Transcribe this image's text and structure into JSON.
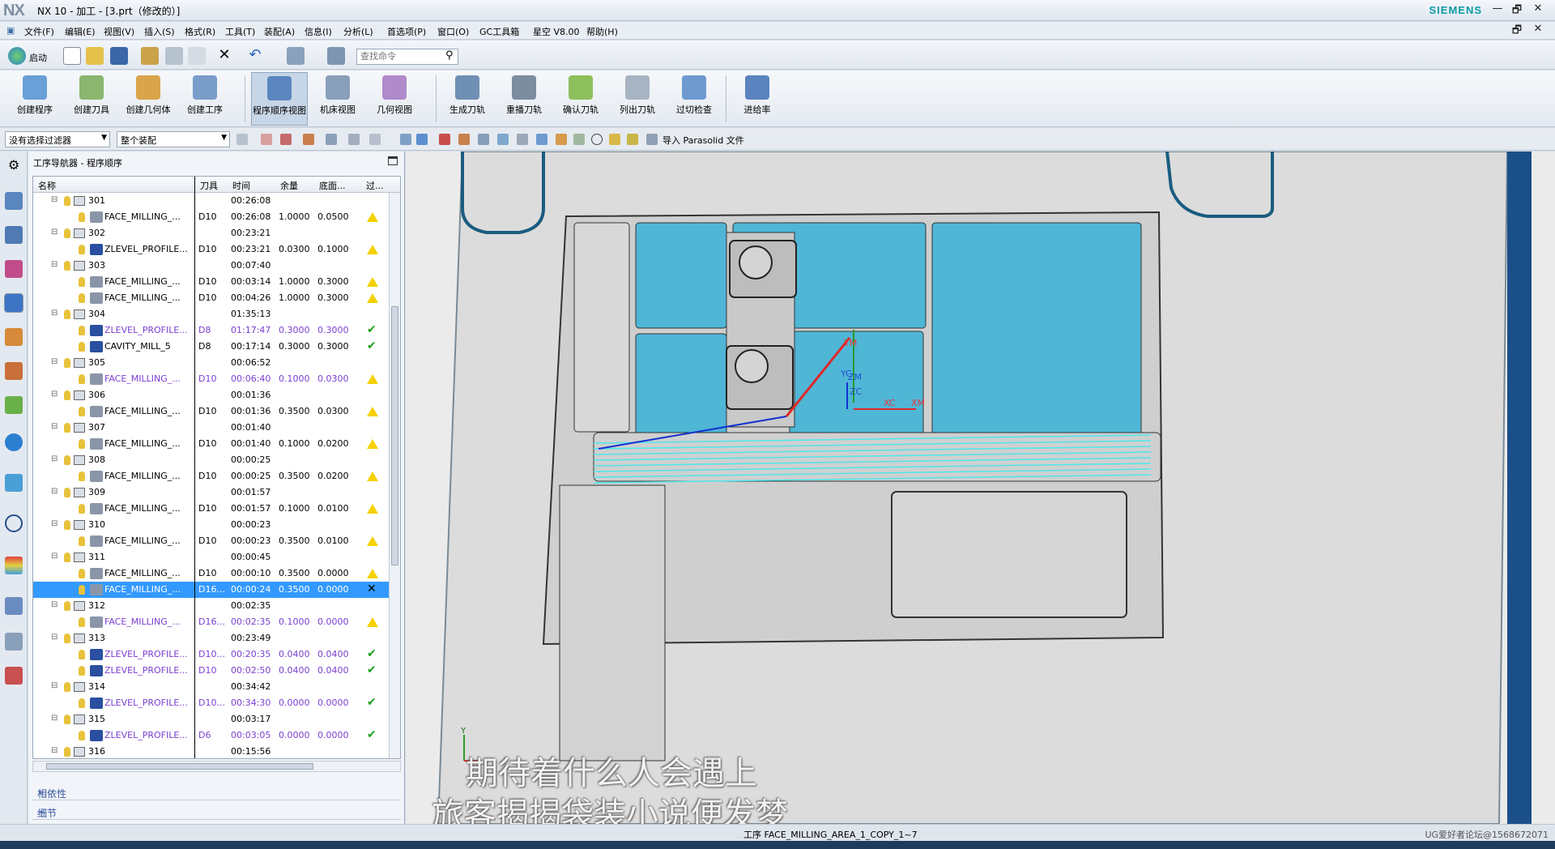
{
  "window": {
    "logo": "NX",
    "title": "NX 10 - 加工 - [3.prt（修改的）]",
    "brand": "SIEMENS",
    "min": "—",
    "restore": "🗗",
    "close": "✕"
  },
  "menu": [
    "文件(F)",
    "编辑(E)",
    "视图(V)",
    "插入(S)",
    "格式(R)",
    "工具(T)",
    "装配(A)",
    "信息(I)",
    "分析(L)",
    "首选项(P)",
    "窗口(O)",
    "GC工具箱",
    "星空 V8.00",
    "帮助(H)"
  ],
  "quick": {
    "start_label": "启动",
    "search_placeholder": "查找命令"
  },
  "ribbon": [
    "创建程序",
    "创建刀具",
    "创建几何体",
    "创建工序",
    "程序顺序视图",
    "机床视图",
    "几何视图",
    "生成刀轨",
    "重播刀轨",
    "确认刀轨",
    "列出刀轨",
    "过切检查",
    "进给率"
  ],
  "filter": {
    "selection_filter": "没有选择过滤器",
    "assembly_scope": "整个装配",
    "import_parasolid": "导入 Parasolid 文件"
  },
  "navigator": {
    "title": "工序导航器 - 程序顺序",
    "columns": [
      "名称",
      "刀具",
      "时间",
      "余量",
      "底面...",
      "过..."
    ],
    "rows": [
      {
        "kind": "group",
        "name": "301",
        "tool": "",
        "time": "00:26:08",
        "stock": "",
        "floor": "",
        "status": ""
      },
      {
        "kind": "op",
        "name": "FACE_MILLING_...",
        "tool": "D10",
        "time": "00:26:08",
        "stock": "1.0000",
        "floor": "0.0500",
        "status": "warn",
        "purple": false
      },
      {
        "kind": "group",
        "name": "302",
        "tool": "",
        "time": "00:23:21",
        "stock": "",
        "floor": "",
        "status": ""
      },
      {
        "kind": "op",
        "name": "ZLEVEL_PROFILE...",
        "tool": "D10",
        "time": "00:23:21",
        "stock": "0.0300",
        "floor": "0.1000",
        "status": "warn",
        "purple": false
      },
      {
        "kind": "group",
        "name": "303",
        "tool": "",
        "time": "00:07:40",
        "stock": "",
        "floor": "",
        "status": ""
      },
      {
        "kind": "op",
        "name": "FACE_MILLING_...",
        "tool": "D10",
        "time": "00:03:14",
        "stock": "1.0000",
        "floor": "0.3000",
        "status": "warn",
        "purple": false
      },
      {
        "kind": "op",
        "name": "FACE_MILLING_...",
        "tool": "D10",
        "time": "00:04:26",
        "stock": "1.0000",
        "floor": "0.3000",
        "status": "warn",
        "purple": false
      },
      {
        "kind": "group",
        "name": "304",
        "tool": "",
        "time": "01:35:13",
        "stock": "",
        "floor": "",
        "status": ""
      },
      {
        "kind": "op",
        "name": "ZLEVEL_PROFILE...",
        "tool": "D8",
        "time": "01:17:47",
        "stock": "0.3000",
        "floor": "0.3000",
        "status": "ok",
        "purple": true
      },
      {
        "kind": "op",
        "name": "CAVITY_MILL_5",
        "tool": "D8",
        "time": "00:17:14",
        "stock": "0.3000",
        "floor": "0.3000",
        "status": "ok",
        "purple": false
      },
      {
        "kind": "group",
        "name": "305",
        "tool": "",
        "time": "00:06:52",
        "stock": "",
        "floor": "",
        "status": ""
      },
      {
        "kind": "op",
        "name": "FACE_MILLING_...",
        "tool": "D10",
        "time": "00:06:40",
        "stock": "0.1000",
        "floor": "0.0300",
        "status": "warn",
        "purple": true
      },
      {
        "kind": "group",
        "name": "306",
        "tool": "",
        "time": "00:01:36",
        "stock": "",
        "floor": "",
        "status": ""
      },
      {
        "kind": "op",
        "name": "FACE_MILLING_...",
        "tool": "D10",
        "time": "00:01:36",
        "stock": "0.3500",
        "floor": "0.0300",
        "status": "warn",
        "purple": false
      },
      {
        "kind": "group",
        "name": "307",
        "tool": "",
        "time": "00:01:40",
        "stock": "",
        "floor": "",
        "status": ""
      },
      {
        "kind": "op",
        "name": "FACE_MILLING_...",
        "tool": "D10",
        "time": "00:01:40",
        "stock": "0.1000",
        "floor": "0.0200",
        "status": "warn",
        "purple": false
      },
      {
        "kind": "group",
        "name": "308",
        "tool": "",
        "time": "00:00:25",
        "stock": "",
        "floor": "",
        "status": ""
      },
      {
        "kind": "op",
        "name": "FACE_MILLING_...",
        "tool": "D10",
        "time": "00:00:25",
        "stock": "0.3500",
        "floor": "0.0200",
        "status": "warn",
        "purple": false
      },
      {
        "kind": "group",
        "name": "309",
        "tool": "",
        "time": "00:01:57",
        "stock": "",
        "floor": "",
        "status": ""
      },
      {
        "kind": "op",
        "name": "FACE_MILLING_...",
        "tool": "D10",
        "time": "00:01:57",
        "stock": "0.1000",
        "floor": "0.0100",
        "status": "warn",
        "purple": false
      },
      {
        "kind": "group",
        "name": "310",
        "tool": "",
        "time": "00:00:23",
        "stock": "",
        "floor": "",
        "status": ""
      },
      {
        "kind": "op",
        "name": "FACE_MILLING_...",
        "tool": "D10",
        "time": "00:00:23",
        "stock": "0.3500",
        "floor": "0.0100",
        "status": "warn",
        "purple": false
      },
      {
        "kind": "group",
        "name": "311",
        "tool": "",
        "time": "00:00:45",
        "stock": "",
        "floor": "",
        "status": ""
      },
      {
        "kind": "op",
        "name": "FACE_MILLING_...",
        "tool": "D10",
        "time": "00:00:10",
        "stock": "0.3500",
        "floor": "0.0000",
        "status": "warn",
        "purple": false
      },
      {
        "kind": "op",
        "name": "FACE_MILLING_...",
        "tool": "D16...",
        "time": "00:00:24",
        "stock": "0.3500",
        "floor": "0.0000",
        "status": "bad",
        "purple": false,
        "selected": true
      },
      {
        "kind": "group",
        "name": "312",
        "tool": "",
        "time": "00:02:35",
        "stock": "",
        "floor": "",
        "status": ""
      },
      {
        "kind": "op",
        "name": "FACE_MILLING_...",
        "tool": "D16...",
        "time": "00:02:35",
        "stock": "0.1000",
        "floor": "0.0000",
        "status": "warn",
        "purple": true
      },
      {
        "kind": "group",
        "name": "313",
        "tool": "",
        "time": "00:23:49",
        "stock": "",
        "floor": "",
        "status": ""
      },
      {
        "kind": "op",
        "name": "ZLEVEL_PROFILE...",
        "tool": "D10...",
        "time": "00:20:35",
        "stock": "0.0400",
        "floor": "0.0400",
        "status": "ok",
        "purple": true
      },
      {
        "kind": "op",
        "name": "ZLEVEL_PROFILE...",
        "tool": "D10",
        "time": "00:02:50",
        "stock": "0.0400",
        "floor": "0.0400",
        "status": "ok",
        "purple": true
      },
      {
        "kind": "group",
        "name": "314",
        "tool": "",
        "time": "00:34:42",
        "stock": "",
        "floor": "",
        "status": ""
      },
      {
        "kind": "op",
        "name": "ZLEVEL_PROFILE...",
        "tool": "D10...",
        "time": "00:34:30",
        "stock": "0.0000",
        "floor": "0.0000",
        "status": "ok",
        "purple": true
      },
      {
        "kind": "group",
        "name": "315",
        "tool": "",
        "time": "00:03:17",
        "stock": "",
        "floor": "",
        "status": ""
      },
      {
        "kind": "op",
        "name": "ZLEVEL_PROFILE...",
        "tool": "D6",
        "time": "00:03:05",
        "stock": "0.0000",
        "floor": "0.0000",
        "status": "ok",
        "purple": true
      },
      {
        "kind": "group",
        "name": "316",
        "tool": "",
        "time": "00:15:56",
        "stock": "",
        "floor": "",
        "status": ""
      }
    ],
    "sections": [
      "相依性",
      "细节"
    ]
  },
  "viewport": {
    "axis_labels": [
      "YM",
      "YC",
      "ZM",
      "ZC",
      "XC",
      "XM"
    ],
    "corner_axis": "Y",
    "subtitles": [
      "期待着什么人会遇上",
      "旅客揭揭袋装小说便发梦"
    ]
  },
  "status": {
    "message": "工序 FACE_MILLING_AREA_1_COPY_1~7",
    "watermark": "UG爱好者论坛@1568672071"
  },
  "colors": {
    "accent_teal": "#0b9aa6",
    "face_blue": "#4fb6d6",
    "toolpath_cyan": "#4fe6ec",
    "selection": "#3399ff",
    "purple_text": "#7a3fd0"
  }
}
